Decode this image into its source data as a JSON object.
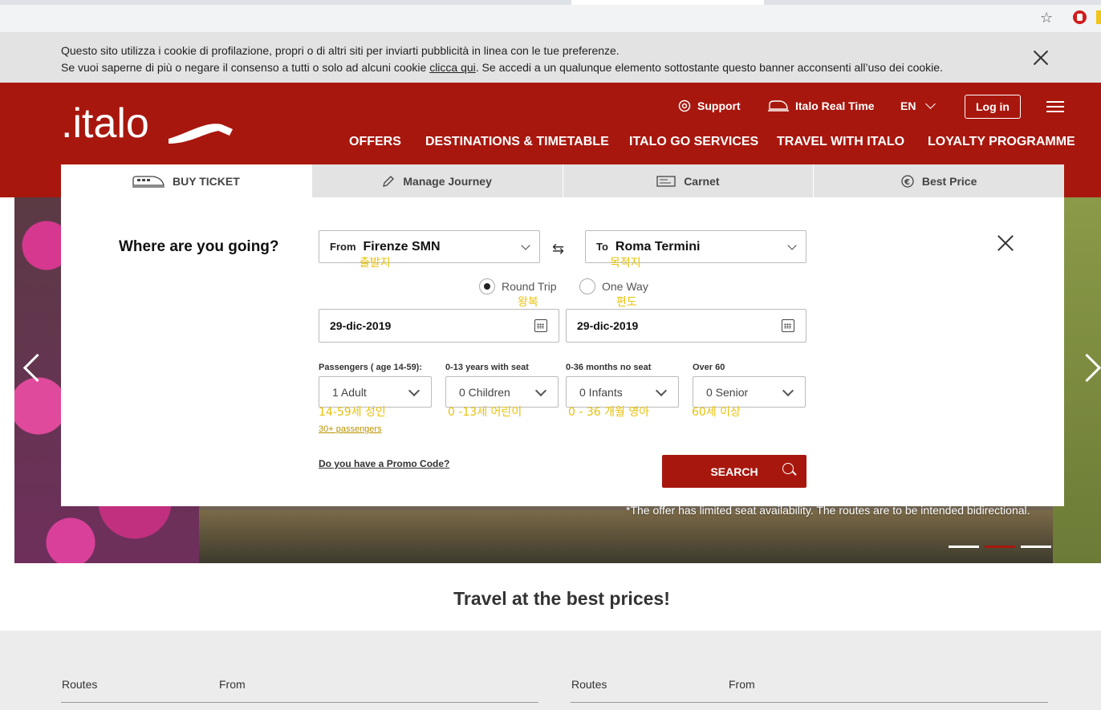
{
  "browser": {
    "star_icon": "star-icon",
    "extension_icon": "shield-extension-icon"
  },
  "cookie": {
    "line1": "Questo sito utilizza i cookie di profilazione, propri o di altri siti per inviarti pubblicità in linea con le tue preferenze.",
    "line2_pre": "Se vuoi saperne di più o negare il consenso a tutti o solo ad alcuni cookie ",
    "link": "clicca qui",
    "line2_post": ". Se accedi a un qualunque elemento sottostante questo banner acconsenti all’uso dei cookie."
  },
  "header": {
    "logo": ".italo",
    "support": "Support",
    "realtime": "Italo Real Time",
    "language": "EN",
    "login": "Log in",
    "nav": [
      "OFFERS",
      "DESTINATIONS & TIMETABLE",
      "ITALO GO SERVICES",
      "TRAVEL WITH ITALO",
      "LOYALTY PROGRAMME"
    ]
  },
  "tabs": [
    {
      "label": "BUY TICKET",
      "icon": "train-icon",
      "active": true
    },
    {
      "label": "Manage Journey",
      "icon": "pencil-icon",
      "active": false
    },
    {
      "label": "Carnet",
      "icon": "ticket-icon",
      "active": false
    },
    {
      "label": "Best Price",
      "icon": "euro-icon",
      "active": false
    }
  ],
  "booking": {
    "heading": "Where are you going?",
    "from_label": "From",
    "from_value": "Firenze SMN",
    "to_label": "To",
    "to_value": "Roma Termini",
    "round_trip": "Round Trip",
    "one_way": "One Way",
    "trip_type_selected": "Round Trip",
    "depart_date": "29-dic-2019",
    "return_date": "29-dic-2019",
    "passengers": [
      {
        "label": "Passengers ( age 14-59):",
        "value": "1 Adult"
      },
      {
        "label": "0-13 years with seat",
        "value": "0 Children"
      },
      {
        "label": "0-36 months no seat",
        "value": "0 Infants"
      },
      {
        "label": "Over 60",
        "value": "0 Senior"
      }
    ],
    "more_passengers": "30+ passengers",
    "promo": "Do you have a Promo Code?",
    "search": "SEARCH"
  },
  "annotations": {
    "from": "출발지",
    "to": "목적지",
    "round": "왕복",
    "oneway": "편도",
    "adult": "14-59세 성인",
    "children": "0 -13세 어린이",
    "infants": "0 - 36 개월 영아",
    "senior": "60세 이상"
  },
  "hero": {
    "offer_note": "*The offer has limited seat availability. The routes are to be intended bidirectional.",
    "slides": 3,
    "active_slide": 2
  },
  "section_title": "Travel at the best prices!",
  "routes": [
    {
      "routes": "Routes",
      "from": "From"
    },
    {
      "routes": "Routes",
      "from": "From"
    }
  ],
  "colors": {
    "brand": "#a8170e",
    "annotation": "#e8c10a",
    "banner": "#e3e3e3"
  }
}
